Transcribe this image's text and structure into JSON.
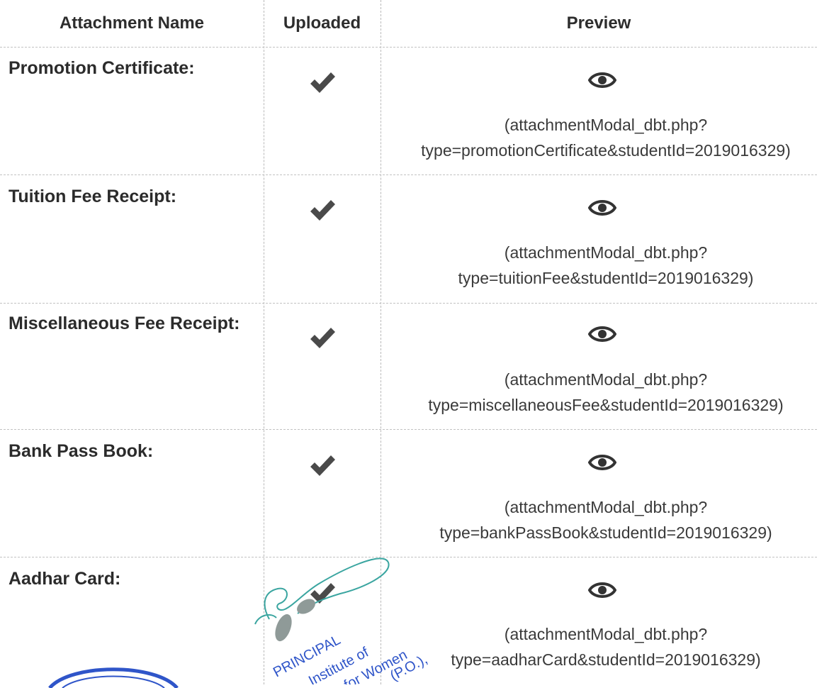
{
  "headers": {
    "name": "Attachment Name",
    "uploaded": "Uploaded",
    "preview": "Preview"
  },
  "rows": [
    {
      "label": "Promotion Certificate:",
      "uploaded": true,
      "preview_icon": "eye-icon",
      "link_line1": "(attachmentModal_dbt.php?",
      "link_line2": "type=promotionCertificate&studentId=2019016329)"
    },
    {
      "label": "Tuition Fee Receipt:",
      "uploaded": true,
      "preview_icon": "eye-icon",
      "link_line1": "(attachmentModal_dbt.php?",
      "link_line2": "type=tuitionFee&studentId=2019016329)"
    },
    {
      "label": "Miscellaneous Fee Receipt:",
      "uploaded": true,
      "preview_icon": "eye-icon",
      "link_line1": "(attachmentModal_dbt.php?",
      "link_line2": "type=miscellaneousFee&studentId=2019016329)"
    },
    {
      "label": "Bank Pass Book:",
      "uploaded": true,
      "preview_icon": "eye-icon",
      "link_line1": "(attachmentModal_dbt.php?",
      "link_line2": "type=bankPassBook&studentId=2019016329)"
    },
    {
      "label": "Aadhar Card:",
      "uploaded": true,
      "preview_icon": "eye-icon",
      "link_line1": "(attachmentModal_dbt.php?",
      "link_line2": "type=aadharCard&studentId=2019016329)"
    }
  ],
  "stamp": {
    "line1": "PRINCIPAL",
    "line2": "Institute of",
    "line3": "for Women",
    "line4": "(P.O.),",
    "color": "#2f55c9"
  },
  "signature_color": "#3aa5a0",
  "check_color": "#4a4a4a"
}
